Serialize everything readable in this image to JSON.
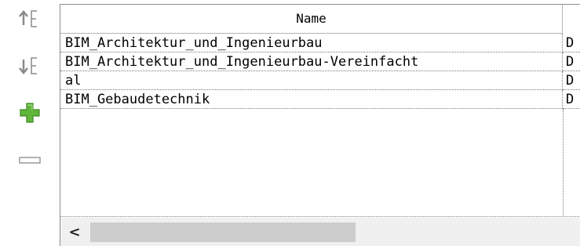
{
  "toolbar": {
    "buttons": [
      {
        "icon": "move-up-icon",
        "color": "#8a8a8a"
      },
      {
        "icon": "move-down-icon",
        "color": "#8a8a8a"
      },
      {
        "icon": "plus-icon",
        "color": "#5fb63a"
      },
      {
        "icon": "minus-icon",
        "color": "#9a9a9a"
      }
    ]
  },
  "table": {
    "columns": [
      "Name"
    ],
    "rows": [
      {
        "name": "BIM_Architektur_und_Ingenieurbau",
        "second": "D"
      },
      {
        "name": "BIM_Architektur_und_Ingenieurbau-Vereinfacht",
        "second": "D"
      },
      {
        "name": "al",
        "second": "D"
      },
      {
        "name": "BIM_Gebaudetechnik",
        "second": "D"
      }
    ]
  },
  "scrollbar": {
    "left_arrow": "<",
    "position": 0.0
  }
}
